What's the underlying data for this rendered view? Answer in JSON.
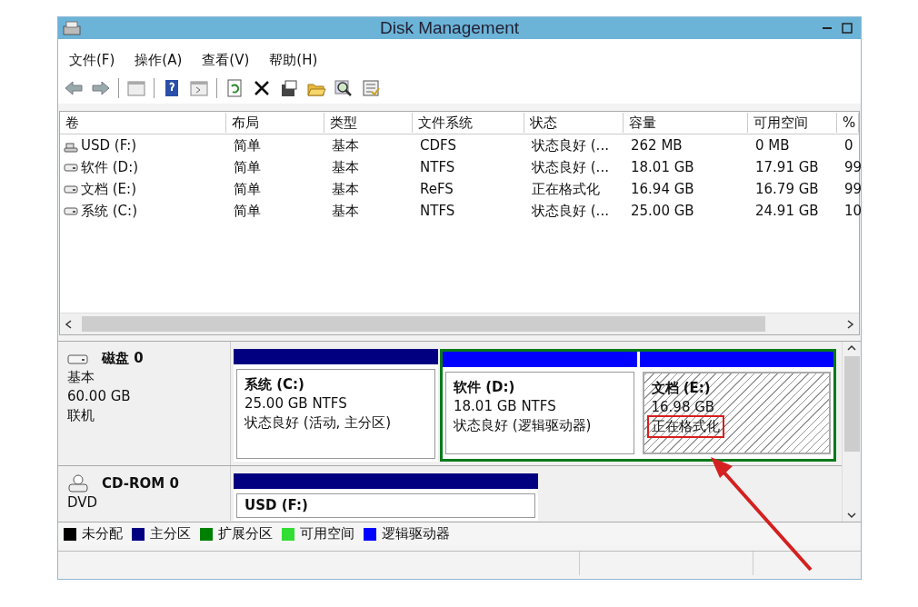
{
  "window": {
    "title": "Disk Management"
  },
  "menu": [
    "文件(F)",
    "操作(A)",
    "查看(V)",
    "帮助(H)"
  ],
  "toolbar": [
    {
      "kind": "back"
    },
    {
      "kind": "forward"
    },
    {
      "kind": "sep"
    },
    {
      "kind": "panel"
    },
    {
      "kind": "sep"
    },
    {
      "kind": "help"
    },
    {
      "kind": "console"
    },
    {
      "kind": "sep"
    },
    {
      "kind": "refresh"
    },
    {
      "kind": "delete"
    },
    {
      "kind": "properties"
    },
    {
      "kind": "folder"
    },
    {
      "kind": "search"
    },
    {
      "kind": "checklist"
    }
  ],
  "table": {
    "columns": [
      "卷",
      "布局",
      "类型",
      "文件系统",
      "状态",
      "容量",
      "可用空间",
      "%"
    ],
    "rows": [
      {
        "kind": "usb",
        "cells": [
          "USD (F:)",
          "简单",
          "基本",
          "CDFS",
          "状态良好 (...",
          "262 MB",
          "0 MB",
          "0"
        ]
      },
      {
        "kind": "disk",
        "cells": [
          "软件 (D:)",
          "简单",
          "基本",
          "NTFS",
          "状态良好 (...",
          "18.01 GB",
          "17.91 GB",
          "99"
        ]
      },
      {
        "kind": "disk",
        "cells": [
          "文档 (E:)",
          "简单",
          "基本",
          "ReFS",
          "正在格式化",
          "16.94 GB",
          "16.79 GB",
          "99"
        ]
      },
      {
        "kind": "disk",
        "cells": [
          "系统 (C:)",
          "简单",
          "基本",
          "NTFS",
          "状态良好 (...",
          "25.00 GB",
          "24.91 GB",
          "10"
        ]
      }
    ]
  },
  "disks": [
    {
      "kind": "disk",
      "name": "磁盘 0",
      "lines": [
        "基本",
        "60.00 GB",
        "联机"
      ],
      "partitions": [
        {
          "kind": "primary",
          "label": "系统  (C:)",
          "lines": [
            "25.00 GB NTFS",
            "状态良好 (活动, 主分区)"
          ],
          "formatting": false,
          "annotated": false
        },
        {
          "kind": "extended",
          "children": [
            {
              "kind": "logical",
              "label": "软件  (D:)",
              "lines": [
                "18.01 GB NTFS",
                "状态良好 (逻辑驱动器)"
              ],
              "formatting": false,
              "annotated": false
            },
            {
              "kind": "logical",
              "label": "文档  (E:)",
              "lines": [
                "16.98 GB",
                "正在格式化"
              ],
              "formatting": true,
              "annotated": true
            }
          ]
        }
      ]
    },
    {
      "kind": "cdrom",
      "name": "CD-ROM 0",
      "lines": [
        "DVD"
      ],
      "partitions": [
        {
          "kind": "primary",
          "label": "USD  (F:)",
          "formatting": false,
          "annotated": false
        }
      ]
    }
  ],
  "legend": [
    {
      "label": "未分配",
      "color": "#000000"
    },
    {
      "label": "主分区",
      "color": "#000080"
    },
    {
      "label": "扩展分区",
      "color": "#008000"
    },
    {
      "label": "可用空间",
      "color": "#33dd33"
    },
    {
      "label": "逻辑驱动器",
      "color": "#0000ff"
    }
  ]
}
